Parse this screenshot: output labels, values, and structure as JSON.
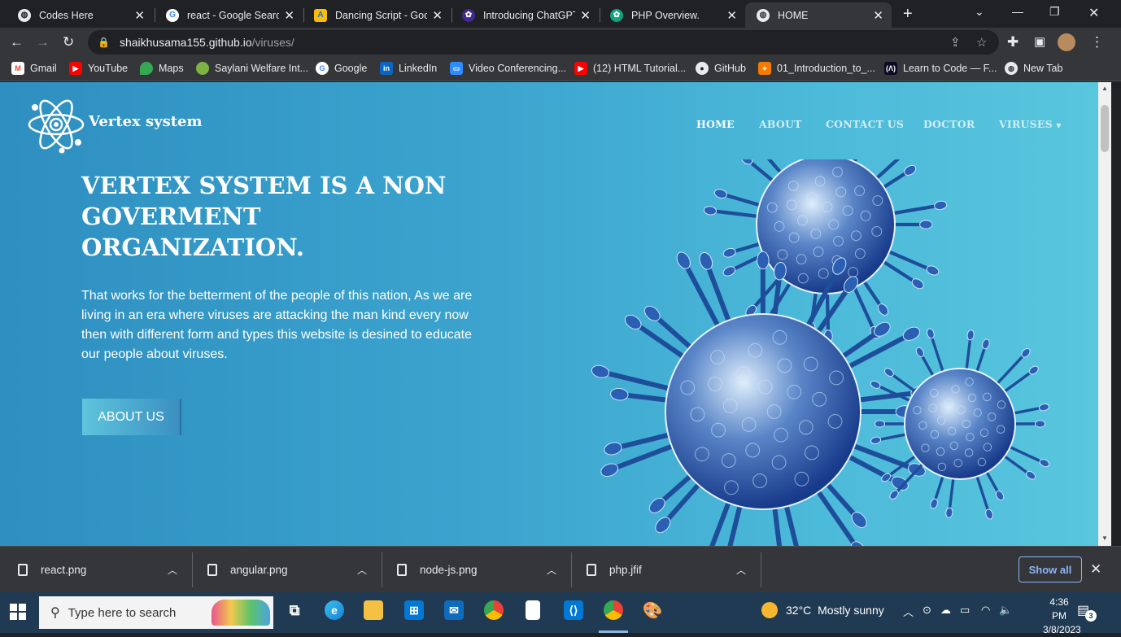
{
  "browser": {
    "tabs": [
      {
        "title": "Codes Here",
        "icon": "globe-icon"
      },
      {
        "title": "react - Google Search",
        "icon": "google-icon"
      },
      {
        "title": "Dancing Script - Goog",
        "icon": "google-fonts-icon"
      },
      {
        "title": "Introducing ChatGPT",
        "icon": "openai-icon"
      },
      {
        "title": "PHP Overview.",
        "icon": "chatgpt-icon"
      },
      {
        "title": "HOME",
        "icon": "globe-icon"
      }
    ],
    "active_tab": 5,
    "url": {
      "host": "shaikhusama155.github.io",
      "path": "/viruses/"
    },
    "bookmarks": [
      {
        "label": "Gmail",
        "icon": "gmail-icon"
      },
      {
        "label": "YouTube",
        "icon": "youtube-icon"
      },
      {
        "label": "Maps",
        "icon": "maps-icon"
      },
      {
        "label": "Saylani Welfare Int...",
        "icon": "saylani-icon"
      },
      {
        "label": "Google",
        "icon": "google-icon"
      },
      {
        "label": "LinkedIn",
        "icon": "linkedin-icon"
      },
      {
        "label": "Video Conferencing...",
        "icon": "zoom-icon"
      },
      {
        "label": "(12) HTML Tutorial...",
        "icon": "youtube-icon"
      },
      {
        "label": "GitHub",
        "icon": "github-icon"
      },
      {
        "label": "01_Introduction_to_...",
        "icon": "file-icon"
      },
      {
        "label": "Learn to Code — F...",
        "icon": "freecodecamp-icon"
      },
      {
        "label": "New Tab",
        "icon": "globe-icon"
      }
    ]
  },
  "site": {
    "brand": "Vertex system",
    "nav": [
      "HOME",
      "ABOUT",
      "CONTACT US",
      "DOCTOR",
      "VIRUSES"
    ],
    "active_nav": 0,
    "hero_title": "VERTEX SYSTEM IS A NON GOVERMENT ORGANIZATION.",
    "hero_text": "That works for the betterment of the people of this nation, As we are living in an era where viruses are attacking the man kind every now then with different form and types this website is desined to educate our people about viruses.",
    "cta_label": "ABOUT US"
  },
  "downloads": {
    "files": [
      "react.png",
      "angular.png",
      "node-js.png",
      "php.jfif"
    ],
    "show_all_label": "Show all"
  },
  "taskbar": {
    "search_placeholder": "Type here to search",
    "weather_temp": "32°C",
    "weather_desc": "Mostly sunny",
    "time": "4:36 PM",
    "date": "3/8/2023",
    "notifications": "3"
  },
  "colors": {
    "chrome_dark": "#202124",
    "chrome_toolbar": "#35363a",
    "page_blue": "#2e8fc0",
    "page_cyan": "#58c6dd",
    "taskbar": "#1f3a52",
    "link_blue": "#8ab4f8"
  }
}
